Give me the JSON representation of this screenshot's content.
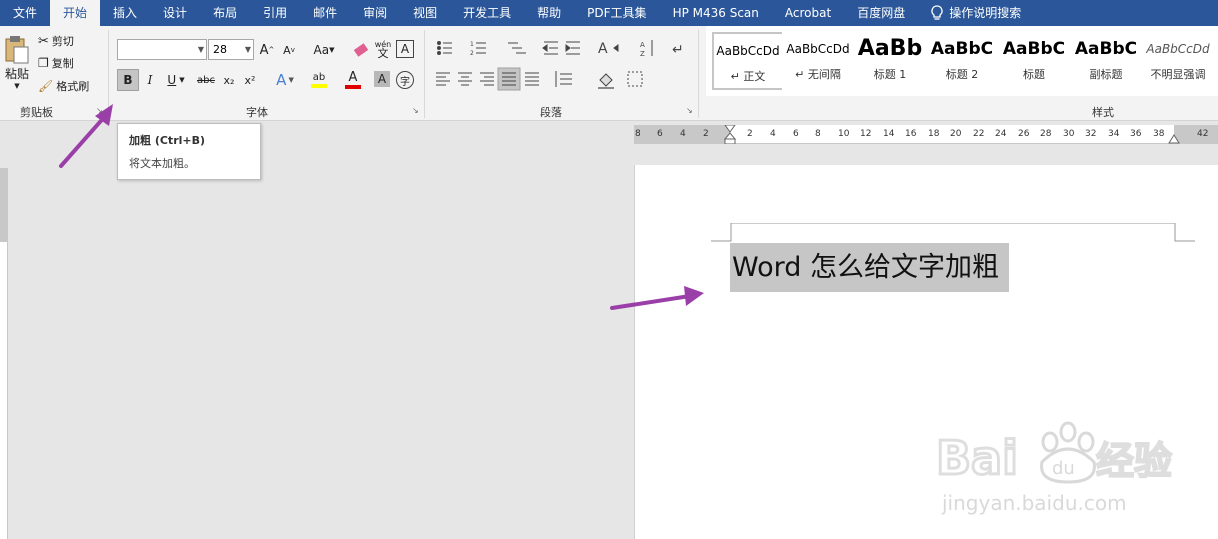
{
  "tabs": [
    "文件",
    "开始",
    "插入",
    "设计",
    "布局",
    "引用",
    "邮件",
    "审阅",
    "视图",
    "开发工具",
    "帮助",
    "PDF工具集",
    "HP M436 Scan",
    "Acrobat",
    "百度网盘",
    "操作说明搜索"
  ],
  "clipboard": {
    "paste": "粘贴",
    "cut": "剪切",
    "copy": "复制",
    "format_painter": "格式刷",
    "group": "剪贴板"
  },
  "font": {
    "name": "",
    "size": "28",
    "group": "字体",
    "bold": "B",
    "italic": "I",
    "underline": "U",
    "strike": "abc",
    "sub": "x₂",
    "sup": "x²",
    "grow": "A",
    "shrink": "A",
    "case": "Aa",
    "phonetic_top": "wén",
    "phonetic_bottom": "文",
    "char_border": "A",
    "text_effect": "A",
    "highlight": "ab",
    "font_color": "A",
    "shade": "A",
    "enclose": "字"
  },
  "paragraph": {
    "group": "段落"
  },
  "styles": {
    "group": "样式",
    "items": [
      {
        "preview": "AaBbCcDd",
        "name": "↵ 正文"
      },
      {
        "preview": "AaBbCcDd",
        "name": "↵ 无间隔"
      },
      {
        "preview": "AaBb",
        "name": "标题 1"
      },
      {
        "preview": "AaBbC",
        "name": "标题 2"
      },
      {
        "preview": "AaBbC",
        "name": "标题"
      },
      {
        "preview": "AaBbC",
        "name": "副标题"
      },
      {
        "preview": "AaBbCcDd",
        "name": "不明显强调"
      }
    ]
  },
  "tooltip": {
    "title": "加粗 (Ctrl+B)",
    "desc": "将文本加粗。"
  },
  "ruler": {
    "ticks": [
      "8",
      "6",
      "4",
      "2",
      "2",
      "4",
      "6",
      "8",
      "10",
      "12",
      "14",
      "16",
      "18",
      "20",
      "22",
      "24",
      "26",
      "28",
      "30",
      "32",
      "34",
      "36",
      "38",
      "42"
    ]
  },
  "document": {
    "text": "Word 怎么给文字加粗"
  },
  "watermark": {
    "brand_left": "Bai",
    "brand_paw": "du",
    "brand_right": "经验",
    "url": "jingyan.baidu.com"
  },
  "colors": {
    "accent": "#2b579a",
    "arrow": "#9b3fa8",
    "highlight_yellow": "#ffff00",
    "font_red": "#e00000"
  }
}
